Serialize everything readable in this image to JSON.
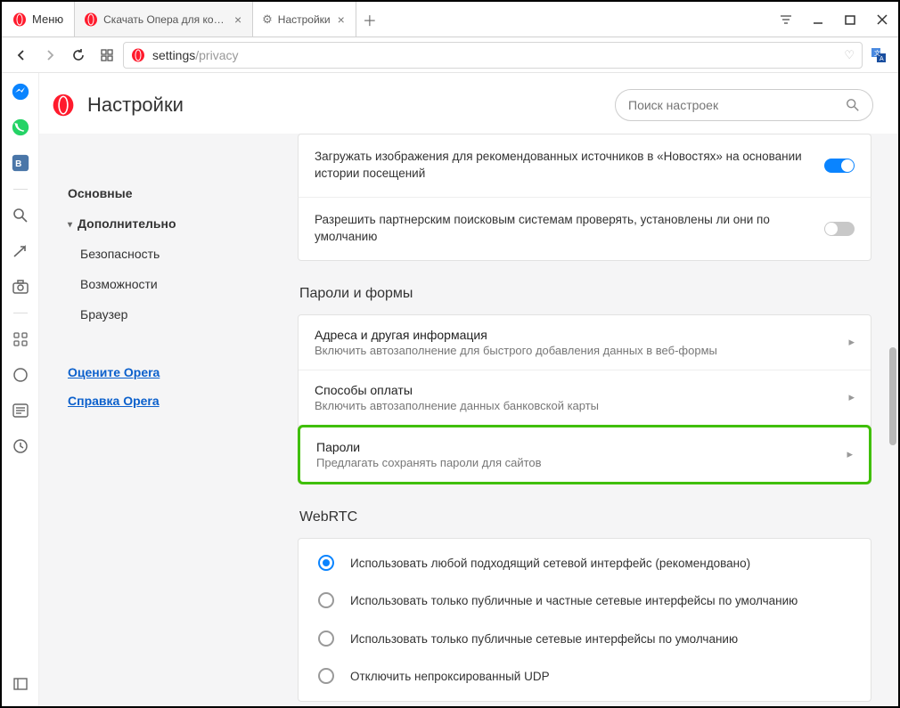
{
  "menu_label": "Меню",
  "tabs": [
    {
      "title": "Скачать Опера для компь"
    },
    {
      "title": "Настройки"
    }
  ],
  "url": {
    "prefix": "settings",
    "suffix": "/privacy"
  },
  "header": {
    "title": "Настройки",
    "search_placeholder": "Поиск настроек"
  },
  "nav": {
    "basic": "Основные",
    "advanced": "Дополнительно",
    "sub": [
      "Безопасность",
      "Возможности",
      "Браузер"
    ],
    "rate": "Оцените Opera",
    "help": "Справка Opera"
  },
  "top_cards": [
    {
      "text": "Загружать изображения для рекомендованных источников в «Новостях» на основании истории посещений",
      "on": true
    },
    {
      "text": "Разрешить партнерским поисковым системам проверять, установлены ли они по умолчанию",
      "on": false
    }
  ],
  "passwords": {
    "section": "Пароли и формы",
    "rows": [
      {
        "title": "Адреса и другая информация",
        "sub": "Включить автозаполнение для быстрого добавления данных в веб-формы",
        "hl": false
      },
      {
        "title": "Способы оплаты",
        "sub": "Включить автозаполнение данных банковской карты",
        "hl": false
      },
      {
        "title": "Пароли",
        "sub": "Предлагать сохранять пароли для сайтов",
        "hl": true
      }
    ]
  },
  "webrtc": {
    "section": "WebRTC",
    "options": [
      {
        "label": "Использовать любой подходящий сетевой интерфейс (рекомендовано)",
        "checked": true
      },
      {
        "label": "Использовать только публичные и частные сетевые интерфейсы по умолчанию",
        "checked": false
      },
      {
        "label": "Использовать только публичные сетевые интерфейсы по умолчанию",
        "checked": false
      },
      {
        "label": "Отключить непроксированный UDP",
        "checked": false
      }
    ]
  }
}
